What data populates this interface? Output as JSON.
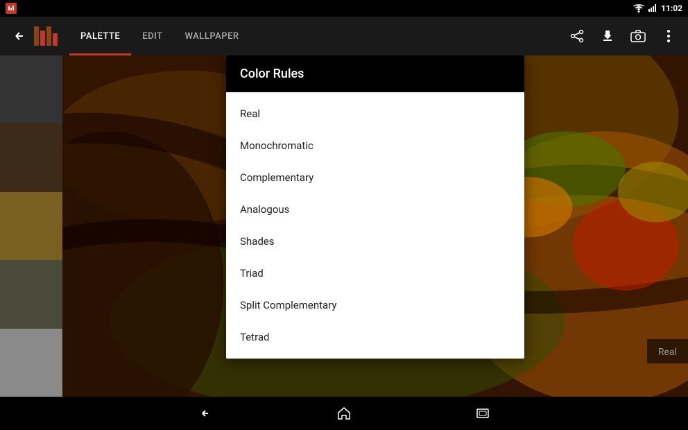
{
  "status_bar": {
    "time": "11:02",
    "wifi_signal": "wifi",
    "battery": "battery"
  },
  "action_bar": {
    "tabs": [
      {
        "id": "palette",
        "label": "PALETTE",
        "active": true
      },
      {
        "id": "edit",
        "label": "EDIT",
        "active": false
      },
      {
        "id": "wallpaper",
        "label": "WALLPAPER",
        "active": false
      }
    ],
    "share_icon": "⬆",
    "download_icon": "⬇",
    "camera_icon": "📷",
    "more_icon": "⋮"
  },
  "palette": {
    "swatches": [
      {
        "id": "swatch-1",
        "color": "#333333"
      },
      {
        "id": "swatch-2",
        "color": "#3d2b1a"
      },
      {
        "id": "swatch-3",
        "color": "#7a6020"
      },
      {
        "id": "swatch-4",
        "color": "#4a4a3a"
      },
      {
        "id": "swatch-5",
        "color": "#8a8a8a"
      }
    ]
  },
  "dialog": {
    "title": "Color Rules",
    "items": [
      {
        "id": "real",
        "label": "Real"
      },
      {
        "id": "monochromatic",
        "label": "Monochromatic"
      },
      {
        "id": "complementary",
        "label": "Complementary"
      },
      {
        "id": "analogous",
        "label": "Analogous"
      },
      {
        "id": "shades",
        "label": "Shades"
      },
      {
        "id": "triad",
        "label": "Triad"
      },
      {
        "id": "split-complementary",
        "label": "Split Complementary"
      },
      {
        "id": "tetrad",
        "label": "Tetrad"
      }
    ]
  },
  "status": {
    "label": "Real"
  },
  "nav": {
    "back": "←",
    "home": "⌂",
    "recents": "▭"
  }
}
